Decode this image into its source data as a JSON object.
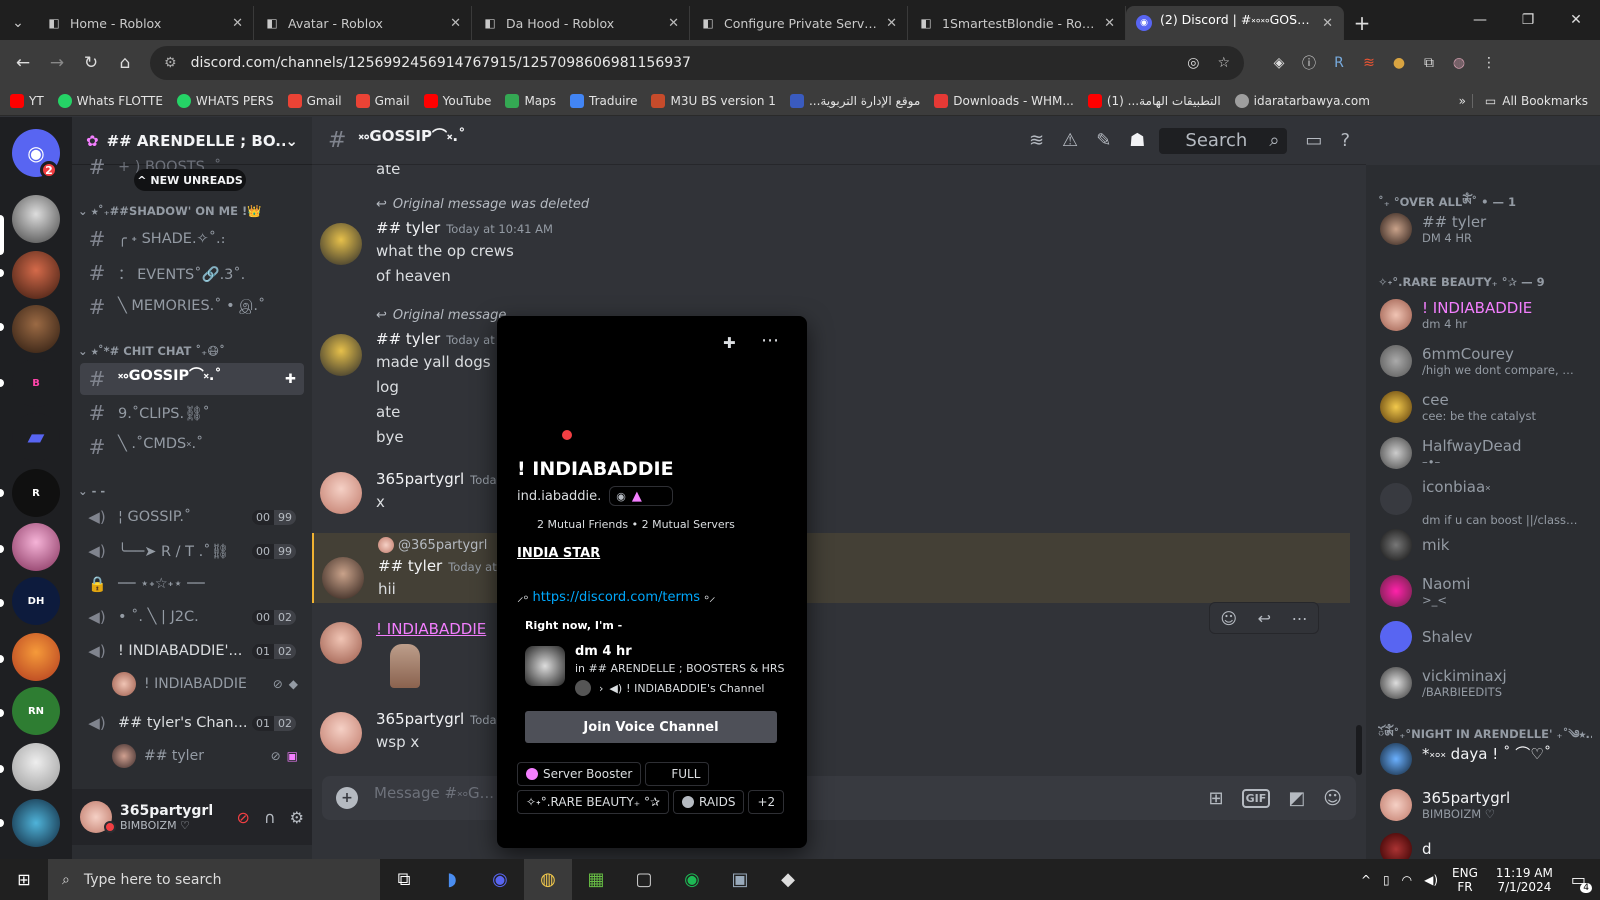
{
  "browser": {
    "tabs": [
      {
        "title": "Home - Roblox",
        "active": false
      },
      {
        "title": "Avatar - Roblox",
        "active": false
      },
      {
        "title": "Da Hood - Roblox",
        "active": false
      },
      {
        "title": "Configure Private Server - Ro",
        "active": false
      },
      {
        "title": "1SmartestBlondie - Roblox",
        "active": false
      },
      {
        "title": "(2) Discord | #༝༚༝༚GOSSIP⌒༝",
        "active": true
      }
    ],
    "url": "discord.com/channels/1256992456914767915/1257098606981156937",
    "bookmarks": [
      {
        "label": "YT",
        "color": "#ff0000"
      },
      {
        "label": "Whats FLOTTE",
        "color": "#25d366"
      },
      {
        "label": "WHATS  PERS",
        "color": "#25d366"
      },
      {
        "label": "Gmail",
        "color": "#ea4335"
      },
      {
        "label": "Gmail",
        "color": "#ea4335"
      },
      {
        "label": "YouTube",
        "color": "#ff0000"
      },
      {
        "label": "Maps",
        "color": "#34a853"
      },
      {
        "label": "Traduire",
        "color": "#4285f4"
      },
      {
        "label": "M3U BS version 1",
        "color": "#c64b2b"
      },
      {
        "label": "...موقع الإدارة التربوية",
        "color": "#3a5bbf"
      },
      {
        "label": "Downloads - WHM...",
        "color": "#e53935"
      },
      {
        "label": "التطبيقات الهامة... (1)",
        "color": "#ff0000"
      },
      {
        "label": "idaratarbawya.com",
        "color": "#9e9e9e"
      }
    ],
    "all_bookmarks": "All Bookmarks"
  },
  "servers": {
    "home_badge": "2"
  },
  "guild": {
    "name": "## ARENDELLE ; BO...",
    "new_unreads": "NEW UNREADS",
    "top_partial": "+ ) BOOSTS .˚",
    "categories": {
      "shadow": "⭑˚₊##SHADOW' ON ME !👑",
      "chitchat": "⭑˚*# CHIT CHAT ˚₊😷˚",
      "voice": "- -"
    },
    "text_channels": [
      {
        "name": "╭ ˖ SHADE.✧˚.։"
      },
      {
        "name": "： EVENTS˚🔗.3˚."
      },
      {
        "name": "╲ MEMORIES.˚ • இ.˚"
      },
      {
        "name": "༝༚GOSSIP⌒༝.˚",
        "selected": true
      },
      {
        "name": "9.˚CLIPS.⛓˚"
      },
      {
        "name": "╲ .˚CMDS༝.˚"
      }
    ],
    "voice_channels": [
      {
        "name": "¦ GOSSIP.˚",
        "count_a": "00",
        "count_b": "99"
      },
      {
        "name": "╰──➤ R / T .˚⛓",
        "count_a": "00",
        "count_b": "99"
      },
      {
        "name": "── ⋆˖☆˖⋆ ──",
        "locked": true
      },
      {
        "name": "• ˚. ╲ | J2C.",
        "count_a": "00",
        "count_b": "02"
      },
      {
        "name": "! INDIABADDIE'...",
        "count_a": "01",
        "count_b": "02"
      },
      {
        "name": "## tyler's Chan...",
        "count_a": "01",
        "count_b": "02"
      }
    ],
    "voice_users": [
      {
        "name": "! INDIABADDIE"
      },
      {
        "name": "## tyler"
      }
    ]
  },
  "user": {
    "name": "365partygrl",
    "status": "BIMBOIZM ♡"
  },
  "chat": {
    "channel_name": "༝༚GOSSIP⌒༝.˚",
    "search_placeholder": "Search",
    "composer_placeholder": "Message #༝༚G...",
    "messages": [
      {
        "id": "m0",
        "text": "ate"
      },
      {
        "id": "m1",
        "reply": "Original message was deleted",
        "author": "## tyler",
        "timestamp": "Today at 10:41 AM",
        "lines": [
          "what the op crews",
          "of heaven"
        ]
      },
      {
        "id": "m2",
        "reply": "Original message",
        "author": "## tyler",
        "timestamp": "Today at",
        "lines": [
          "made yall dogs",
          "log",
          "ate",
          "bye"
        ]
      },
      {
        "id": "m3",
        "author": "365partygrl",
        "timestamp": "Today",
        "lines": [
          "x"
        ]
      },
      {
        "id": "m4",
        "reply": "@365partygrl",
        "author": "## tyler",
        "timestamp": "Today at",
        "lines": [
          "hii"
        ]
      },
      {
        "id": "m5",
        "author": "! INDIABADDIE",
        "lines": []
      },
      {
        "id": "m6",
        "author": "365partygrl",
        "timestamp": "Today",
        "lines": [
          "wsp x"
        ]
      }
    ]
  },
  "profile": {
    "display_name": "! INDIABADDIE",
    "username": "ind.iabaddie.",
    "mutual_friends": "2 Mutual Friends",
    "mutual_servers": "2 Mutual Servers",
    "bio_title": "INDIA STAR",
    "bio_link": "https://discord.com/terms",
    "bio_link_prefix": "⸝༚",
    "bio_link_suffix": "༚⸝",
    "right_now": "Right now, I'm -",
    "activity_title": "dm 4 hr",
    "activity_server": "in ## ARENDELLE ; BOOSTERS & HRS",
    "activity_channel": "! INDIABADDIE's Channel",
    "join_button": "Join Voice Channel",
    "roles": [
      "Server Booster",
      "FULL",
      "✧˖°.RARE BEAUTY₊ °✰",
      "RAIDS",
      "+2"
    ]
  },
  "members": {
    "groups": [
      {
        "title": "˚₊ °OVER ALLༀ˚ • — 1"
      },
      {
        "title": "✧˖°.RARE BEAUTY₊ °✰ — 9"
      },
      {
        "title": "ོༀ˚₊°NIGHT IN ARENDELLE' ₊˚༄⭑..."
      }
    ],
    "list": [
      {
        "name": "## tyler",
        "status": "DM 4 HR",
        "color": "#949ba4"
      },
      {
        "name": "! INDIABADDIE",
        "status": "dm 4 hr",
        "color": "#f47fff"
      },
      {
        "name": "6mmCourey",
        "status": "/high we dont compare, wish ...",
        "color": "#949ba4"
      },
      {
        "name": "cee",
        "status": "cee: be the catalyst",
        "color": "#949ba4"
      },
      {
        "name": "HalfwayDead",
        "status": "–•–",
        "color": "#949ba4"
      },
      {
        "name": "iconbiaa༝",
        "status": "dm if u can boost ||/classy...",
        "color": "#949ba4"
      },
      {
        "name": "mik",
        "status": "",
        "color": "#949ba4"
      },
      {
        "name": "Naomi",
        "status": ">_<",
        "color": "#949ba4"
      },
      {
        "name": "Shalev",
        "status": "",
        "color": "#949ba4"
      },
      {
        "name": "vickiminaxj",
        "status": "/BARBIEEDITS",
        "color": "#949ba4"
      },
      {
        "name": "*༝༚༝ daya ! ˚ ⌒♡˚",
        "status": "",
        "color": "#f2f3f5"
      },
      {
        "name": "365partygrl",
        "status": "BIMBOIZM ♡",
        "color": "#f2f3f5"
      },
      {
        "name": "d",
        "status": "",
        "color": "#f2f3f5"
      }
    ]
  },
  "taskbar": {
    "search": "Type here to search",
    "lang": "ENG",
    "lang2": "FR",
    "time": "11:19 AM",
    "date": "7/1/2024",
    "notif": "4"
  }
}
